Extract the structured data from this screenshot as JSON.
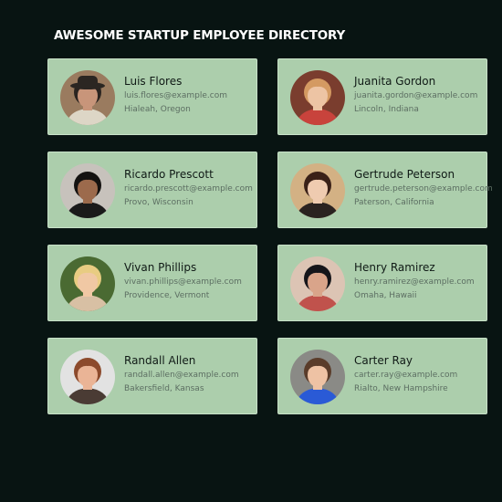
{
  "header": {
    "title": "AWESOME STARTUP EMPLOYEE DIRECTORY"
  },
  "employees": [
    {
      "name": "Luis Flores",
      "email": "luis.flores@example.com",
      "location": "Hialeah, Oregon",
      "avatar": {
        "bg": "#9a7b5f",
        "skin": "#c8957a",
        "hair": "#2a2420",
        "shirt": "#ddd6c6",
        "hat": "#2b2622"
      }
    },
    {
      "name": "Juanita Gordon",
      "email": "juanita.gordon@example.com",
      "location": "Lincoln, Indiana",
      "avatar": {
        "bg": "#7a3d2e",
        "skin": "#edc4a4",
        "hair": "#d49a62",
        "shirt": "#c8433c",
        "hat": ""
      }
    },
    {
      "name": "Ricardo Prescott",
      "email": "ricardo.prescott@example.com",
      "location": "Provo, Wisconsin",
      "avatar": {
        "bg": "#c7c2bc",
        "skin": "#9c6a4c",
        "hair": "#141210",
        "shirt": "#1a1a1a",
        "hat": ""
      }
    },
    {
      "name": "Gertrude Peterson",
      "email": "gertrude.peterson@example.com",
      "location": "Paterson, California",
      "avatar": {
        "bg": "#d3b184",
        "skin": "#efcbb0",
        "hair": "#3a2118",
        "shirt": "#2a2320",
        "hat": ""
      }
    },
    {
      "name": "Vivan Phillips",
      "email": "vivan.phillips@example.com",
      "location": "Providence, Vermont",
      "avatar": {
        "bg": "#4a6a32",
        "skin": "#f0c8a4",
        "hair": "#e8cc82",
        "shirt": "#d8c0a4",
        "hat": ""
      }
    },
    {
      "name": "Henry Ramirez",
      "email": "henry.ramirez@example.com",
      "location": "Omaha, Hawaii",
      "avatar": {
        "bg": "#dcc4b4",
        "skin": "#d9a48a",
        "hair": "#15151a",
        "shirt": "#c0524c",
        "hat": ""
      }
    },
    {
      "name": "Randall Allen",
      "email": "randall.allen@example.com",
      "location": "Bakersfield, Kansas",
      "avatar": {
        "bg": "#e2e2e2",
        "skin": "#eab496",
        "hair": "#8c4a2c",
        "shirt": "#4a3b34",
        "hat": ""
      }
    },
    {
      "name": "Carter Ray",
      "email": "carter.ray@example.com",
      "location": "Rialto, New Hampshire",
      "avatar": {
        "bg": "#8a8a86",
        "skin": "#eec2a4",
        "hair": "#5a3c2a",
        "shirt": "#2a5ad6",
        "hat": ""
      }
    }
  ]
}
